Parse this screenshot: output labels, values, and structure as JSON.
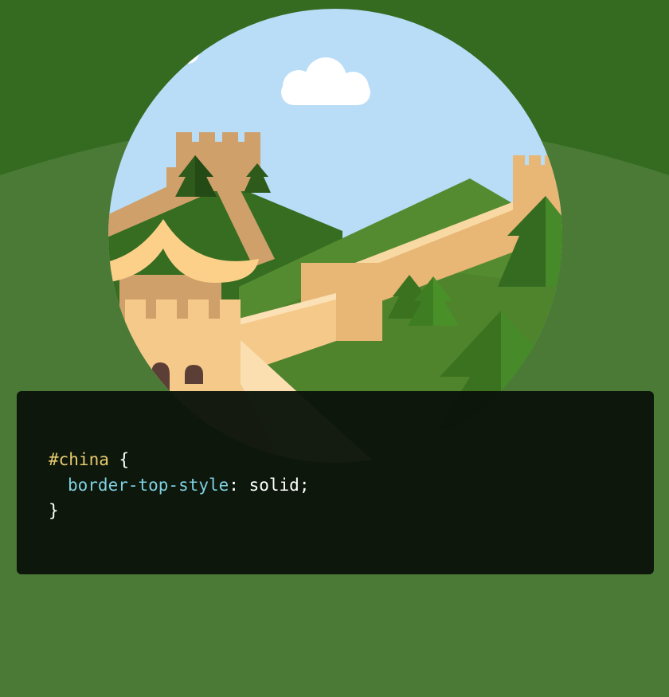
{
  "code": {
    "selector": "#china",
    "open_brace": " {",
    "property": "border-top-style",
    "colon": ":",
    "value": " solid",
    "semicolon": ";",
    "close_brace": "}"
  },
  "colors": {
    "page_background": "#4a7a36",
    "top_band": "#346b20",
    "panel_background": "#0a130a",
    "selector": "#e6cc6e",
    "property": "#7fcfe0",
    "text": "#ffffff",
    "sky": "#b9dcf7",
    "wall_light": "#f5c98a",
    "wall_mid": "#e8b675",
    "wall_dark": "#cfa06a"
  },
  "icons": [
    "cloud-icon",
    "pine-tree-icon",
    "wall-tower-icon",
    "pagoda-roof-icon"
  ]
}
